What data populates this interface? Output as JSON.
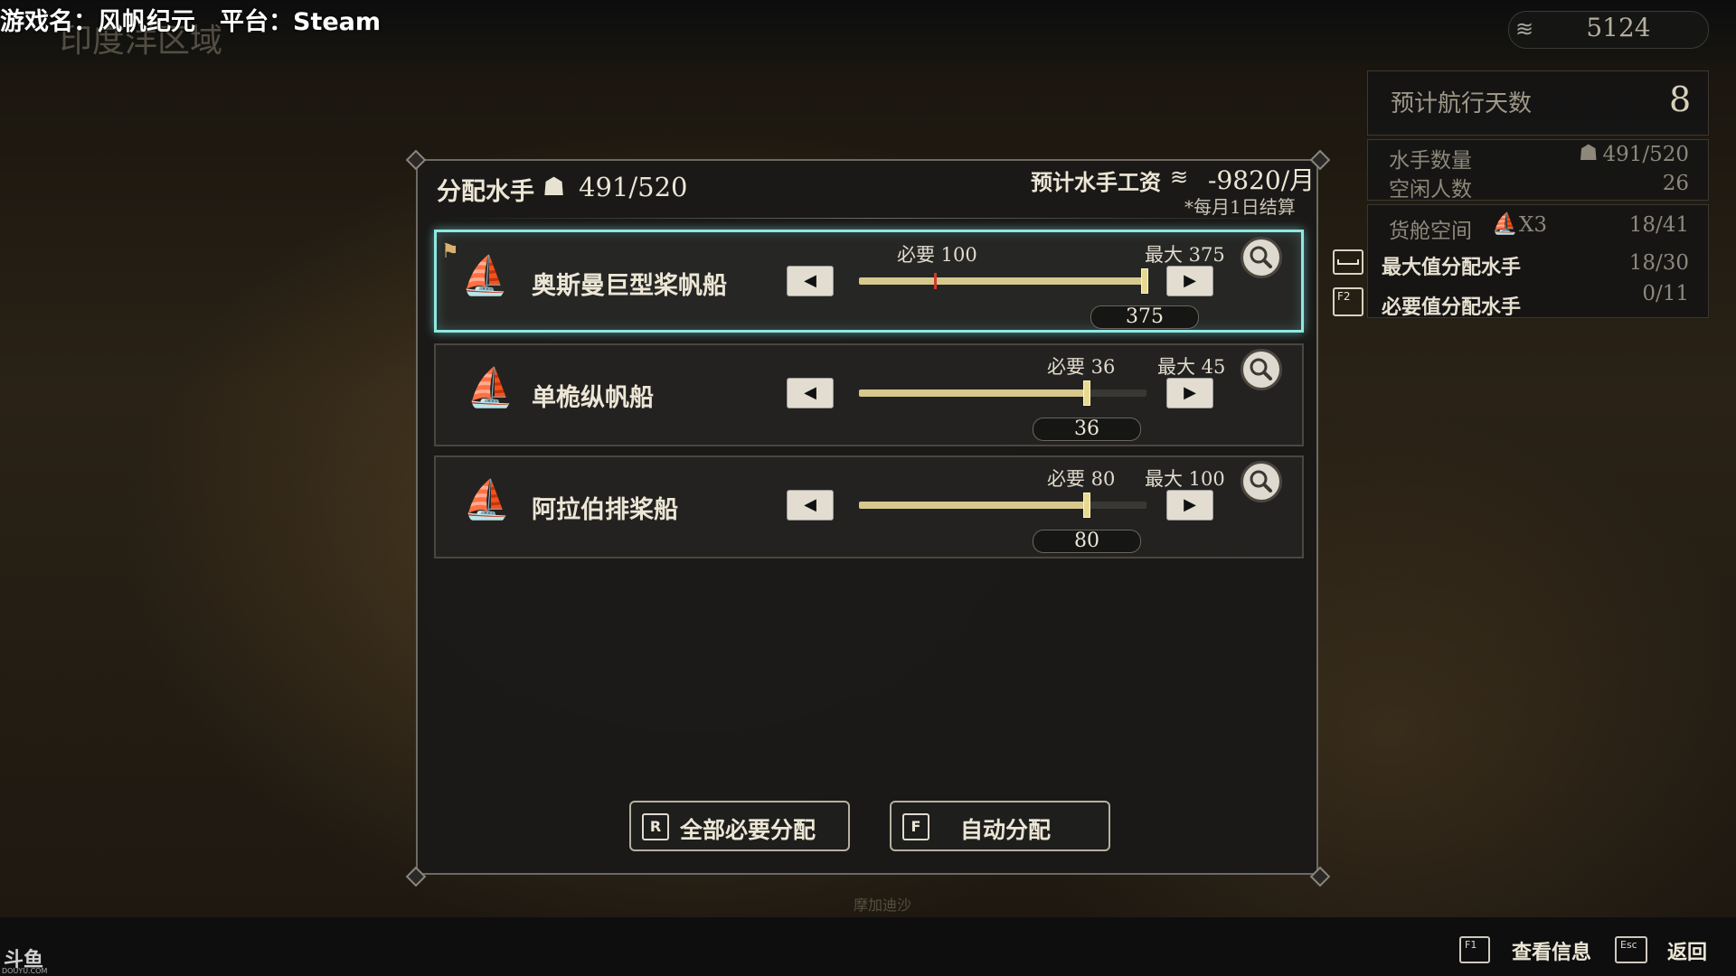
{
  "stream_title": "游戏名：风帆纪元　平台：Steam",
  "region": "印度洋区域",
  "coins": {
    "icon": "coins-icon",
    "value": "5124"
  },
  "right_panel": {
    "days_label": "预计航行天数",
    "days_value": "8",
    "sailors_label": "水手数量",
    "sailors_value": "491/520",
    "idle_label": "空闲人数",
    "idle_value": "26",
    "cargo_label": "货舱空间",
    "cargo_mult": "X3",
    "cargo_value": "18/41",
    "max_assign": {
      "key": "",
      "label": "最大值分配水手",
      "value": "18/30"
    },
    "need_assign": {
      "key": "F2",
      "label": "必要值分配水手",
      "value": "0/11"
    }
  },
  "dialog": {
    "title": "分配水手",
    "count": "491/520",
    "wage_label": "预计水手工资",
    "wage_value": "-9820/月",
    "wage_note": "*每月1日结算",
    "ships": [
      {
        "name": "奥斯曼巨型桨帆船",
        "need": "必要 100",
        "max": "最大 375",
        "value": "375",
        "need_frac": 0.267,
        "value_frac": 1.0
      },
      {
        "name": "单桅纵帆船",
        "need": "必要 36",
        "max": "最大 45",
        "value": "36",
        "need_frac": 0.8,
        "value_frac": 0.8
      },
      {
        "name": "阿拉伯排桨船",
        "need": "必要 80",
        "max": "最大 100",
        "value": "80",
        "need_frac": 0.8,
        "value_frac": 0.8
      }
    ],
    "btn_all_need": {
      "key": "R",
      "label": "全部必要分配"
    },
    "btn_auto": {
      "key": "F",
      "label": "自动分配"
    }
  },
  "footer": {
    "info_key": "F1",
    "info_label": "查看信息",
    "back_key": "Esc",
    "back_label": "返回"
  },
  "watermark": {
    "name": "斗鱼",
    "sub": "DOUYU.COM"
  },
  "map_labels": [
    "摩加迪沙"
  ],
  "colors": {
    "selection": "#8ee8e2",
    "slider_fill": "#d6c98e",
    "need_marker": "#d23a2e"
  }
}
